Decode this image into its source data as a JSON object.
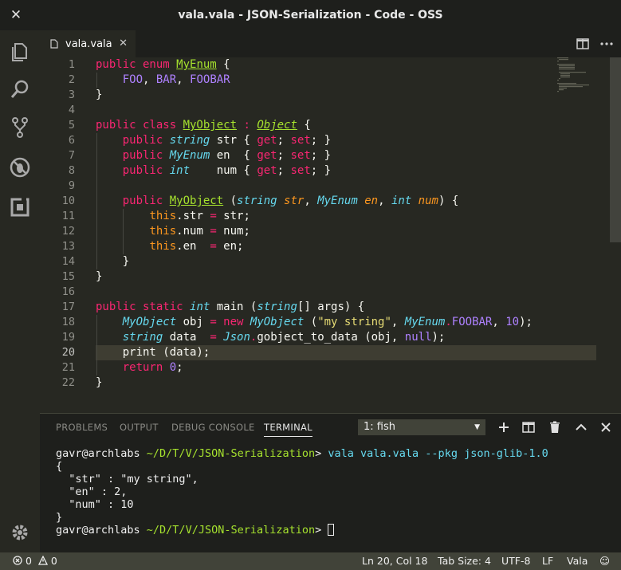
{
  "window": {
    "title": "vala.vala - JSON-Serialization - Code - OSS"
  },
  "activity_bar": {
    "icons": [
      "files-icon",
      "search-icon",
      "source-control-icon",
      "debug-icon",
      "extensions-icon",
      "settings-gear-icon"
    ]
  },
  "tabs": [
    {
      "label": "vala.vala",
      "icon": "file-icon"
    }
  ],
  "editor": {
    "line_numbers": [
      "1",
      "2",
      "3",
      "4",
      "5",
      "6",
      "7",
      "8",
      "9",
      "10",
      "11",
      "12",
      "13",
      "14",
      "15",
      "16",
      "17",
      "18",
      "19",
      "20",
      "21",
      "22"
    ],
    "current_line": "20",
    "lines": [
      [
        {
          "t": "public enum ",
          "c": "kw"
        },
        {
          "t": "MyEnum",
          "c": "typ"
        },
        {
          "t": " {",
          "c": ""
        }
      ],
      [
        {
          "t": "    ",
          "c": ""
        },
        {
          "t": "FOO",
          "c": "cst"
        },
        {
          "t": ", ",
          "c": ""
        },
        {
          "t": "BAR",
          "c": "cst"
        },
        {
          "t": ", ",
          "c": ""
        },
        {
          "t": "FOOBAR",
          "c": "cst"
        }
      ],
      [
        {
          "t": "}",
          "c": ""
        }
      ],
      [],
      [
        {
          "t": "public class ",
          "c": "kw"
        },
        {
          "t": "MyObject",
          "c": "typ"
        },
        {
          "t": " : ",
          "c": "kw"
        },
        {
          "t": "Object",
          "c": "ital"
        },
        {
          "t": " {",
          "c": ""
        }
      ],
      [
        {
          "t": "    ",
          "c": ""
        },
        {
          "t": "public ",
          "c": "kw"
        },
        {
          "t": "string",
          "c": "tyi"
        },
        {
          "t": " str { ",
          "c": ""
        },
        {
          "t": "get",
          "c": "kw"
        },
        {
          "t": "; ",
          "c": ""
        },
        {
          "t": "set",
          "c": "kw"
        },
        {
          "t": "; }",
          "c": ""
        }
      ],
      [
        {
          "t": "    ",
          "c": ""
        },
        {
          "t": "public ",
          "c": "kw"
        },
        {
          "t": "MyEnum",
          "c": "tyi"
        },
        {
          "t": " en  { ",
          "c": ""
        },
        {
          "t": "get",
          "c": "kw"
        },
        {
          "t": "; ",
          "c": ""
        },
        {
          "t": "set",
          "c": "kw"
        },
        {
          "t": "; }",
          "c": ""
        }
      ],
      [
        {
          "t": "    ",
          "c": ""
        },
        {
          "t": "public ",
          "c": "kw"
        },
        {
          "t": "int",
          "c": "tyi"
        },
        {
          "t": "    num { ",
          "c": ""
        },
        {
          "t": "get",
          "c": "kw"
        },
        {
          "t": "; ",
          "c": ""
        },
        {
          "t": "set",
          "c": "kw"
        },
        {
          "t": "; }",
          "c": ""
        }
      ],
      [],
      [
        {
          "t": "    ",
          "c": ""
        },
        {
          "t": "public ",
          "c": "kw"
        },
        {
          "t": "MyObject",
          "c": "typ"
        },
        {
          "t": " (",
          "c": ""
        },
        {
          "t": "string",
          "c": "tyi"
        },
        {
          "t": " ",
          "c": ""
        },
        {
          "t": "str",
          "c": "par"
        },
        {
          "t": ", ",
          "c": ""
        },
        {
          "t": "MyEnum",
          "c": "tyi"
        },
        {
          "t": " ",
          "c": ""
        },
        {
          "t": "en",
          "c": "par"
        },
        {
          "t": ", ",
          "c": ""
        },
        {
          "t": "int",
          "c": "tyi"
        },
        {
          "t": " ",
          "c": ""
        },
        {
          "t": "num",
          "c": "par"
        },
        {
          "t": ") {",
          "c": ""
        }
      ],
      [
        {
          "t": "        ",
          "c": ""
        },
        {
          "t": "this",
          "c": "ths"
        },
        {
          "t": ".str ",
          "c": ""
        },
        {
          "t": "=",
          "c": "kw"
        },
        {
          "t": " str;",
          "c": ""
        }
      ],
      [
        {
          "t": "        ",
          "c": ""
        },
        {
          "t": "this",
          "c": "ths"
        },
        {
          "t": ".num ",
          "c": ""
        },
        {
          "t": "=",
          "c": "kw"
        },
        {
          "t": " num;",
          "c": ""
        }
      ],
      [
        {
          "t": "        ",
          "c": ""
        },
        {
          "t": "this",
          "c": "ths"
        },
        {
          "t": ".en  ",
          "c": ""
        },
        {
          "t": "=",
          "c": "kw"
        },
        {
          "t": " en;",
          "c": ""
        }
      ],
      [
        {
          "t": "    }",
          "c": ""
        }
      ],
      [
        {
          "t": "}",
          "c": ""
        }
      ],
      [],
      [
        {
          "t": "public static ",
          "c": "kw"
        },
        {
          "t": "int",
          "c": "tyi"
        },
        {
          "t": " main (",
          "c": ""
        },
        {
          "t": "string",
          "c": "tyi"
        },
        {
          "t": "[] args) {",
          "c": ""
        }
      ],
      [
        {
          "t": "    ",
          "c": ""
        },
        {
          "t": "MyObject",
          "c": "tyi"
        },
        {
          "t": " obj ",
          "c": ""
        },
        {
          "t": "= new ",
          "c": "kw"
        },
        {
          "t": "MyObject",
          "c": "tyi"
        },
        {
          "t": " (",
          "c": ""
        },
        {
          "t": "\"my string\"",
          "c": "str"
        },
        {
          "t": ", ",
          "c": ""
        },
        {
          "t": "MyEnum",
          "c": "tyi"
        },
        {
          "t": ".",
          "c": "kw"
        },
        {
          "t": "FOOBAR",
          "c": "cst"
        },
        {
          "t": ", ",
          "c": ""
        },
        {
          "t": "10",
          "c": "cst"
        },
        {
          "t": ");",
          "c": ""
        }
      ],
      [
        {
          "t": "    ",
          "c": ""
        },
        {
          "t": "string",
          "c": "tyi"
        },
        {
          "t": " data  ",
          "c": ""
        },
        {
          "t": "=",
          "c": "kw"
        },
        {
          "t": " ",
          "c": ""
        },
        {
          "t": "Json",
          "c": "tyi"
        },
        {
          "t": ".",
          "c": "kw"
        },
        {
          "t": "gobject_to_data (obj, ",
          "c": ""
        },
        {
          "t": "null",
          "c": "cst"
        },
        {
          "t": ");",
          "c": ""
        }
      ],
      [
        {
          "t": "    print (data);",
          "c": ""
        }
      ],
      [
        {
          "t": "    ",
          "c": ""
        },
        {
          "t": "return ",
          "c": "kw"
        },
        {
          "t": "0",
          "c": "cst"
        },
        {
          "t": ";",
          "c": ""
        }
      ],
      [
        {
          "t": "}",
          "c": ""
        }
      ]
    ]
  },
  "panel": {
    "tabs": [
      "PROBLEMS",
      "OUTPUT",
      "DEBUG CONSOLE",
      "TERMINAL"
    ],
    "active_tab": "TERMINAL",
    "terminal_select": "1: fish",
    "terminal_lines": [
      [
        {
          "t": "gavr@archlabs ",
          "c": ""
        },
        {
          "t": "~/D/T/V/JSON-Serialization",
          "c": "pgreen"
        },
        {
          "t": "> ",
          "c": ""
        },
        {
          "t": "vala vala.vala --pkg json-glib-1.0",
          "c": "pblue"
        }
      ],
      [
        {
          "t": "{",
          "c": ""
        }
      ],
      [
        {
          "t": "  \"str\" : \"my string\",",
          "c": ""
        }
      ],
      [
        {
          "t": "  \"en\" : 2,",
          "c": ""
        }
      ],
      [
        {
          "t": "  \"num\" : 10",
          "c": ""
        }
      ],
      [
        {
          "t": "}",
          "c": ""
        }
      ],
      [
        {
          "t": "gavr@archlabs ",
          "c": ""
        },
        {
          "t": "~/D/T/V/JSON-Serialization",
          "c": "pgreen"
        },
        {
          "t": "> ",
          "c": ""
        }
      ]
    ]
  },
  "statusbar": {
    "errors": "0",
    "warnings": "0",
    "position": "Ln 20, Col 18",
    "tab_size": "Tab Size: 4",
    "encoding": "UTF-8",
    "eol": "LF",
    "language": "Vala"
  }
}
